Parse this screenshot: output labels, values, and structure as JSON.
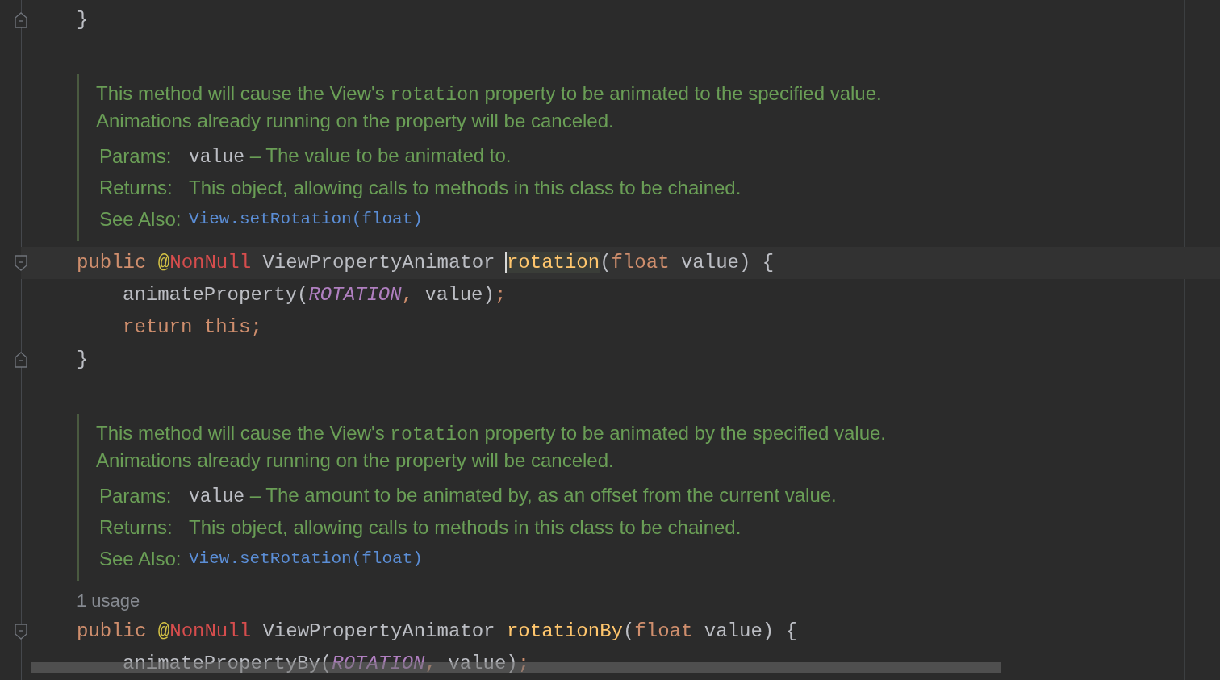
{
  "editor": {
    "lines": [
      {
        "kind": "code",
        "fold_start": false,
        "fold_end": true,
        "indented": false,
        "current": false,
        "tokens": [
          {
            "text": "}",
            "kind": "plain"
          }
        ]
      },
      {
        "kind": "blank"
      },
      {
        "kind": "doc",
        "paragraph": [
          [
            {
              "text": "This method will cause the View's ",
              "kind": "text"
            },
            {
              "text": "rotation",
              "kind": "code"
            },
            {
              "text": " property to be animated to the specified value.",
              "kind": "text"
            }
          ],
          [
            {
              "text": "Animations already running on the property will be canceled.",
              "kind": "text"
            }
          ]
        ],
        "tags": [
          {
            "label": "Params:",
            "parts": [
              {
                "text": "value",
                "kind": "param"
              },
              {
                "text": " – The value to be animated to.",
                "kind": "text"
              }
            ]
          },
          {
            "label": "Returns:",
            "parts": [
              {
                "text": "This object, allowing calls to methods in this class to be chained.",
                "kind": "text"
              }
            ]
          },
          {
            "label": "See Also:",
            "parts": [
              {
                "text": "View.setRotation(float)",
                "kind": "link"
              }
            ]
          }
        ]
      },
      {
        "kind": "code",
        "fold_start": true,
        "fold_end": false,
        "indented": false,
        "current": true,
        "tokens": [
          {
            "text": "public ",
            "kind": "keyword"
          },
          {
            "text": "@",
            "kind": "at"
          },
          {
            "text": "NonNull",
            "kind": "annotation"
          },
          {
            "text": " ViewPropertyAnimator ",
            "kind": "plain"
          },
          {
            "text": "rotation",
            "kind": "decl",
            "caret": true
          },
          {
            "text": "(",
            "kind": "plain"
          },
          {
            "text": "float",
            "kind": "keyword"
          },
          {
            "text": " value) {",
            "kind": "plain"
          }
        ]
      },
      {
        "kind": "code",
        "fold_start": false,
        "fold_end": false,
        "indented": true,
        "current": false,
        "tokens": [
          {
            "text": "animateProperty(",
            "kind": "plain"
          },
          {
            "text": "ROTATION",
            "kind": "constant"
          },
          {
            "text": ", ",
            "kind": "punct"
          },
          {
            "text": "value)",
            "kind": "plain"
          },
          {
            "text": ";",
            "kind": "punct"
          }
        ]
      },
      {
        "kind": "code",
        "fold_start": false,
        "fold_end": false,
        "indented": true,
        "current": false,
        "tokens": [
          {
            "text": "return this;",
            "kind": "keyword"
          }
        ]
      },
      {
        "kind": "code",
        "fold_start": false,
        "fold_end": true,
        "indented": false,
        "current": false,
        "tokens": [
          {
            "text": "}",
            "kind": "plain"
          }
        ]
      },
      {
        "kind": "blank"
      },
      {
        "kind": "doc",
        "paragraph": [
          [
            {
              "text": "This method will cause the View's ",
              "kind": "text"
            },
            {
              "text": "rotation",
              "kind": "code"
            },
            {
              "text": " property to be animated by the specified value.",
              "kind": "text"
            }
          ],
          [
            {
              "text": "Animations already running on the property will be canceled.",
              "kind": "text"
            }
          ]
        ],
        "tags": [
          {
            "label": "Params:",
            "parts": [
              {
                "text": "value",
                "kind": "param"
              },
              {
                "text": " – The amount to be animated by, as an offset from the current value.",
                "kind": "text"
              }
            ]
          },
          {
            "label": "Returns:",
            "parts": [
              {
                "text": "This object, allowing calls to methods in this class to be chained.",
                "kind": "text"
              }
            ]
          },
          {
            "label": "See Also:",
            "parts": [
              {
                "text": "View.setRotation(float)",
                "kind": "link"
              }
            ]
          }
        ]
      },
      {
        "kind": "usage",
        "text": "1 usage"
      },
      {
        "kind": "code",
        "fold_start": true,
        "fold_end": false,
        "indented": false,
        "current": false,
        "tokens": [
          {
            "text": "public ",
            "kind": "keyword"
          },
          {
            "text": "@",
            "kind": "at"
          },
          {
            "text": "NonNull",
            "kind": "annotation"
          },
          {
            "text": " ViewPropertyAnimator ",
            "kind": "plain"
          },
          {
            "text": "rotationBy",
            "kind": "decl"
          },
          {
            "text": "(",
            "kind": "plain"
          },
          {
            "text": "float",
            "kind": "keyword"
          },
          {
            "text": " value) {",
            "kind": "plain"
          }
        ]
      },
      {
        "kind": "code",
        "fold_start": false,
        "fold_end": false,
        "indented": true,
        "current": false,
        "tokens": [
          {
            "text": "animatePropertyBy(",
            "kind": "plain"
          },
          {
            "text": "ROTATION",
            "kind": "constant"
          },
          {
            "text": ", ",
            "kind": "punct"
          },
          {
            "text": "value)",
            "kind": "plain"
          },
          {
            "text": ";",
            "kind": "punct"
          }
        ]
      }
    ]
  }
}
